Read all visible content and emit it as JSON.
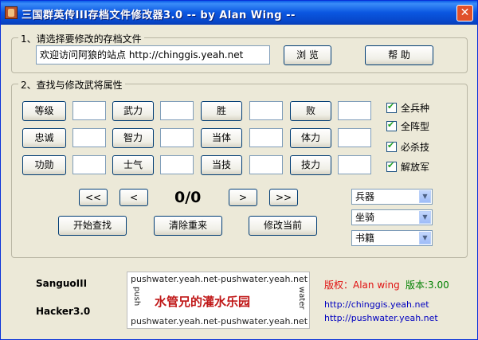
{
  "window": {
    "title": "三国群英传III存档文件修改器3.0 -- by Alan Wing --",
    "close_glyph": "✕"
  },
  "file_group": {
    "legend": "1、请选择要修改的存档文件",
    "file_value": "欢迎访问阿狼的站点 http://chinggis.yeah.net",
    "browse_label": "浏 览",
    "help_label": "帮 助"
  },
  "search_group": {
    "legend": "2、查找与修改武将属性",
    "attributes": [
      "等级",
      "武力",
      "胜",
      "败",
      "忠诚",
      "智力",
      "当体",
      "体力",
      "功勋",
      "士气",
      "当技",
      "技力"
    ],
    "checkboxes": [
      {
        "label": "全兵种",
        "checked": true
      },
      {
        "label": "全阵型",
        "checked": true
      },
      {
        "label": "必杀技",
        "checked": true
      },
      {
        "label": "解放军",
        "checked": true
      }
    ],
    "nav": {
      "first": "<<",
      "prev": "<",
      "counter": "0/0",
      "next": ">",
      "last": ">>"
    },
    "start_search_label": "开始查找",
    "reset_label": "清除重来",
    "modify_label": "修改当前",
    "selects": [
      "兵器",
      "坐骑",
      "书籍"
    ]
  },
  "footer": {
    "name_line1": "SanguoIII",
    "name_line2": "Hacker3.0",
    "logo_top": "pushwater.yeah.net-pushwater.yeah.net",
    "logo_left": "push",
    "logo_main": "水管兄的灌水乐园",
    "logo_right": "water",
    "logo_bottom": "pushwater.yeah.net-pushwater.yeah.net",
    "copyright": "版权：Alan wing",
    "version": "版本:3.00",
    "link1": "http://chinggis.yeah.net",
    "link2": "http://pushwater.yeah.net"
  },
  "colors": {
    "title_bar": "#0a56e0",
    "copyright": "#e01010",
    "version": "#008000",
    "links": "#0000c0",
    "logo_text": "#c01818"
  }
}
